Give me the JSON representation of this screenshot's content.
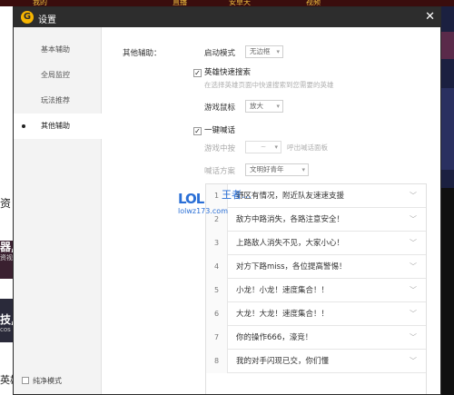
{
  "background": {
    "top_tabs": [
      "我的",
      "直播",
      "安卓天",
      "视频"
    ],
    "left_texts": [
      "资",
      "器,",
      "资视",
      "技,",
      "cos",
      "英雄观战"
    ]
  },
  "dialog": {
    "logo_glyph": "G",
    "title": "设置",
    "close_glyph": "✕"
  },
  "sidebar": {
    "items": [
      {
        "label": "基本辅助"
      },
      {
        "label": "全局监控"
      },
      {
        "label": "玩法推荐"
      },
      {
        "label": "其他辅助"
      }
    ],
    "active_index": 3,
    "pure_mode_label": "纯净模式",
    "pure_mode_checked": false
  },
  "content": {
    "section_label": "其他辅助：",
    "launch_mode": {
      "label": "启动模式",
      "value": "无边框"
    },
    "hero_search": {
      "label": "英雄快速搜索",
      "checked": true,
      "hint": "在选择英雄页面中快速搜索到您需要的英雄"
    },
    "game_mouse": {
      "label": "游戏鼠标",
      "value": "放大"
    },
    "quick_shout": {
      "label": "一键喊话",
      "checked": true
    },
    "game_hotkey": {
      "label": "游戏中按",
      "value": "~",
      "suffix": "呼出喊话面板"
    },
    "shout_scheme": {
      "label": "喊话方案",
      "value": "文明好青年"
    },
    "phrases": [
      {
        "num": "1",
        "text": "野区有情况，附近队友速速支援"
      },
      {
        "num": "2",
        "text": "敌方中路消失，各路注意安全！"
      },
      {
        "num": "3",
        "text": "上路敌人消失不见，大家小心！"
      },
      {
        "num": "4",
        "text": "对方下路miss，各位提高警惕！"
      },
      {
        "num": "5",
        "text": "小龙！小龙！速度集合！！"
      },
      {
        "num": "6",
        "text": "大龙！大龙！速度集合！！"
      },
      {
        "num": "7",
        "text": "你的操作666，濠竞！"
      },
      {
        "num": "8",
        "text": "我的对手闪现已交，你们懂"
      }
    ],
    "chevron_glyph": "﹀"
  },
  "watermark": {
    "logo": "LOL",
    "cn": "王者…",
    "site": "lolwz173.com"
  }
}
